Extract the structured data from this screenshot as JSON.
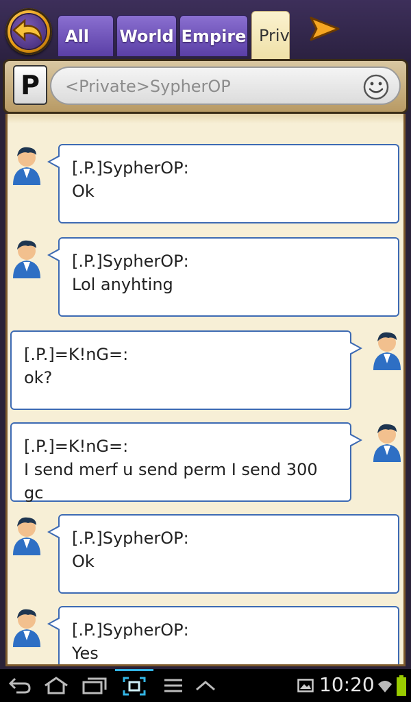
{
  "tabs": [
    {
      "label": "All"
    },
    {
      "label": "World"
    },
    {
      "label": "Empire"
    },
    {
      "label": "Priv"
    }
  ],
  "channel_badge": "P",
  "input": {
    "placeholder": "<Private>SypherOP",
    "value": ""
  },
  "messages": [
    {
      "sender": "[.P.]SypherOP:",
      "text": "Ok",
      "side": "left"
    },
    {
      "sender": "[.P.]SypherOP:",
      "text": "Lol anyhting",
      "side": "left"
    },
    {
      "sender": "[.P.]=K!nG=:",
      "text": "ok?",
      "side": "right"
    },
    {
      "sender": "[.P.]=K!nG=:",
      "text": "I send merf u send perm I send 300\ngc",
      "side": "right"
    },
    {
      "sender": "[.P.]SypherOP:",
      "text": "Ok",
      "side": "left"
    },
    {
      "sender": "[.P.]SypherOP:",
      "text": "Yes",
      "side": "left"
    }
  ],
  "status_bar": {
    "time": "10:20"
  },
  "colors": {
    "tab_active": "#efe0a8",
    "tab_inactive": "#6b4fb8",
    "bubble_border": "#3d6ab3",
    "panel_bg": "#f7efd6"
  },
  "icons": [
    "back-arrow-icon",
    "next-arrow-icon",
    "smiley-icon",
    "avatar-icon",
    "nav-back-icon",
    "nav-home-icon",
    "nav-recents-icon",
    "screenshot-icon",
    "menu-icon",
    "up-chevron-icon",
    "gallery-icon",
    "wifi-icon",
    "battery-icon"
  ]
}
